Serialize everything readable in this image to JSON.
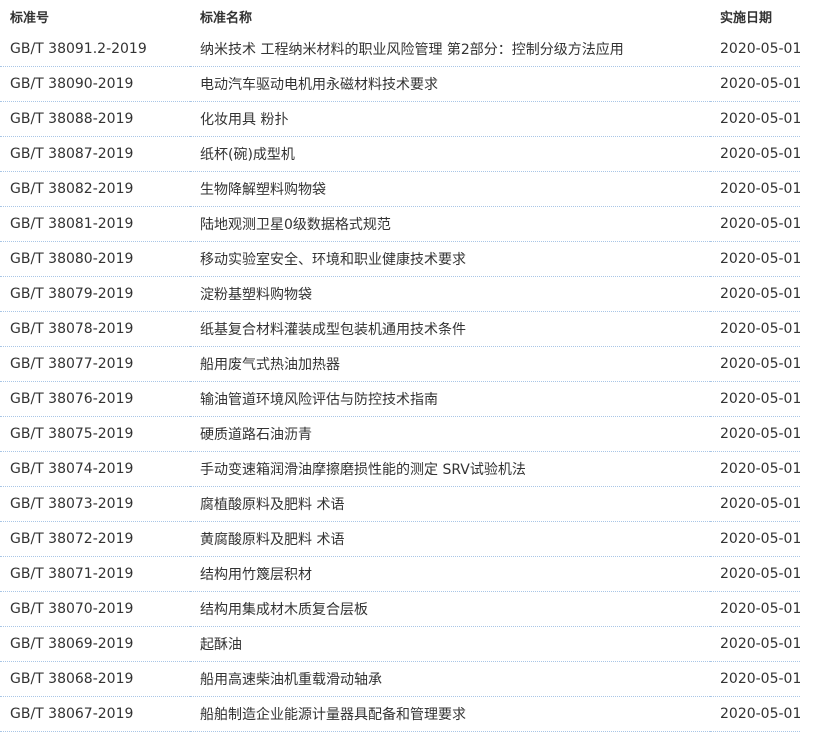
{
  "table": {
    "headers": {
      "code": "标准号",
      "name": "标准名称",
      "date": "实施日期"
    },
    "rows": [
      {
        "code": "GB/T 38091.2-2019",
        "name": "纳米技术 工程纳米材料的职业风险管理 第2部分：控制分级方法应用",
        "date": "2020-05-01"
      },
      {
        "code": "GB/T 38090-2019",
        "name": "电动汽车驱动电机用永磁材料技术要求",
        "date": "2020-05-01"
      },
      {
        "code": "GB/T 38088-2019",
        "name": "化妆用具 粉扑",
        "date": "2020-05-01"
      },
      {
        "code": "GB/T 38087-2019",
        "name": "纸杯(碗)成型机",
        "date": "2020-05-01"
      },
      {
        "code": "GB/T 38082-2019",
        "name": "生物降解塑料购物袋",
        "date": "2020-05-01"
      },
      {
        "code": "GB/T 38081-2019",
        "name": "陆地观测卫星0级数据格式规范",
        "date": "2020-05-01"
      },
      {
        "code": "GB/T 38080-2019",
        "name": "移动实验室安全、环境和职业健康技术要求",
        "date": "2020-05-01"
      },
      {
        "code": "GB/T 38079-2019",
        "name": "淀粉基塑料购物袋",
        "date": "2020-05-01"
      },
      {
        "code": "GB/T 38078-2019",
        "name": "纸基复合材料灌装成型包装机通用技术条件",
        "date": "2020-05-01"
      },
      {
        "code": "GB/T 38077-2019",
        "name": "船用废气式热油加热器",
        "date": "2020-05-01"
      },
      {
        "code": "GB/T 38076-2019",
        "name": "输油管道环境风险评估与防控技术指南",
        "date": "2020-05-01"
      },
      {
        "code": "GB/T 38075-2019",
        "name": "硬质道路石油沥青",
        "date": "2020-05-01"
      },
      {
        "code": "GB/T 38074-2019",
        "name": "手动变速箱润滑油摩擦磨损性能的测定 SRV试验机法",
        "date": "2020-05-01"
      },
      {
        "code": "GB/T 38073-2019",
        "name": "腐植酸原料及肥料 术语",
        "date": "2020-05-01"
      },
      {
        "code": "GB/T 38072-2019",
        "name": "黄腐酸原料及肥料 术语",
        "date": "2020-05-01"
      },
      {
        "code": "GB/T 38071-2019",
        "name": "结构用竹篾层积材",
        "date": "2020-05-01"
      },
      {
        "code": "GB/T 38070-2019",
        "name": "结构用集成材木质复合层板",
        "date": "2020-05-01"
      },
      {
        "code": "GB/T 38069-2019",
        "name": "起酥油",
        "date": "2020-05-01"
      },
      {
        "code": "GB/T 38068-2019",
        "name": "船用高速柴油机重载滑动轴承",
        "date": "2020-05-01"
      },
      {
        "code": "GB/T 38067-2019",
        "name": "船舶制造企业能源计量器具配备和管理要求",
        "date": "2020-05-01"
      }
    ]
  },
  "colors": {
    "text": "#333333",
    "row_divider": "#a9c6e6",
    "background": "#ffffff"
  }
}
